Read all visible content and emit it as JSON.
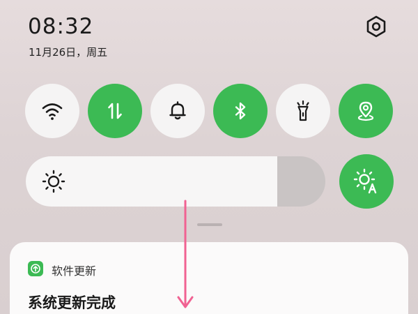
{
  "status": {
    "time": "08:32",
    "date": "11月26日，周五"
  },
  "quick_settings": {
    "tiles": [
      {
        "icon": "wifi-icon",
        "active": false
      },
      {
        "icon": "mobile-data-icon",
        "active": true
      },
      {
        "icon": "bell-icon",
        "active": false
      },
      {
        "icon": "bluetooth-icon",
        "active": true
      },
      {
        "icon": "flashlight-icon",
        "active": false
      },
      {
        "icon": "location-icon",
        "active": true
      }
    ],
    "brightness": {
      "level_percent": 84,
      "icon": "sun-icon",
      "auto_icon": "auto-brightness-icon",
      "auto_active": true
    }
  },
  "notification": {
    "app_name": "软件更新",
    "title": "系统更新完成"
  },
  "colors": {
    "accent_green": "#3cba54",
    "tile_off": "#f5f4f4",
    "swipe_arrow": "#f06292"
  }
}
